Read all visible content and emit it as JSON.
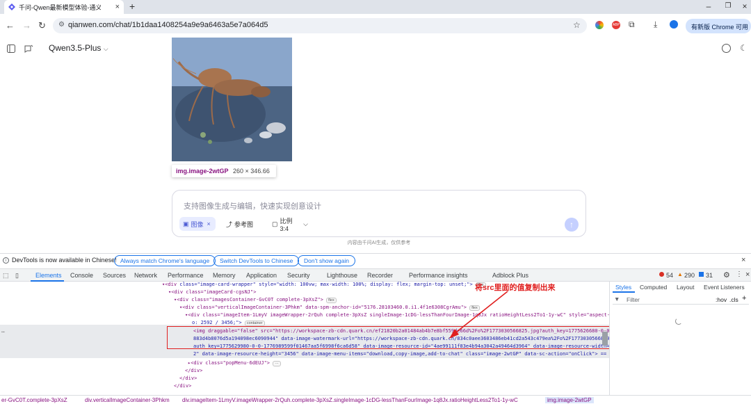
{
  "browser": {
    "tab_title": "千问-Qwen最新模型体验-通义",
    "url": "qianwen.com/chat/1b1daa1408254a9e9a6463a5e7a064d5",
    "new_version_label": "有新版 Chrome 可用"
  },
  "app": {
    "model_name": "Qwen3.5-Plus"
  },
  "image_tooltip": {
    "selector": "img.image-2wtGP",
    "size": "260 × 346.66"
  },
  "chat_input": {
    "placeholder": "支持图像生成与编辑，快速实现创意设计",
    "chip_image": "图像",
    "chip_reference": "参考图",
    "chip_ratio": "比例 3:4",
    "disclaimer": "内容由千问AI生成，仅供参考"
  },
  "devtools_notice": {
    "text": "DevTools is now available in Chinese!",
    "btn_match": "Always match Chrome's language",
    "btn_switch": "Switch DevTools to Chinese",
    "btn_dont_show": "Don't show again"
  },
  "devtools_tabs": [
    "Elements",
    "Console",
    "Sources",
    "Network",
    "Performance",
    "Memory",
    "Application",
    "Security",
    "Lighthouse",
    "Recorder",
    "Performance insights",
    "Adblock Plus"
  ],
  "counters": {
    "errors": "54",
    "warnings": "290",
    "info": "31"
  },
  "styles_tabs": [
    "Styles",
    "Computed",
    "Layout",
    "Event Listeners"
  ],
  "styles_filter": {
    "placeholder": "Filter",
    "hov": ":hov",
    "cls": ".cls"
  },
  "annotation": "将src里面的值复制出来",
  "code": {
    "l1_open": "<div",
    "l1_attrs": " class=\"image-card-wrapper\" style=\"width: 100vw; max-width: 100%; display: flex; margin-top: unset;\">",
    "l2": "<div class=\"imageCard-cgsNJ\">",
    "l3": "<div class=\"imagesContainer-GvC0T complete-3pXsZ\">",
    "l4": "<div class=\"verticalImageContainer-3Phkm\" data-spm-anchor-id=\"5176.28103460.0.i1.4f1e6308CgrAmu\">",
    "l5": "<div class=\"imageItem-1LmyV imageWrapper-2rQuh complete-3pXsZ singleImage-1cDG-lessThanFourImage-1q8Jx ratioHeightLess2To1-1y-wC\" style=\"aspect-rati",
    "l6": "o: 2592 / 3456;\">",
    "l7": "<img draggable=\"false\" src=\"https://workspace-zb-cdn.quark.cn/ef21820b2a01484ab4b7e8bf559de66d%2Fo%2F1773030566825.jpg?auth_key=1775626680-0-0-47a5",
    "l8": "883d4b8076d5a194098ec6090944\" data-image-watermark-url=\"https://workspace-zb-cdn.quark.cn/834c0aee3603486eb41cd2a543c479ea%2Fo%2F1773030566840.png?",
    "l9": "auth_key=1775629980-0-0-1776989599f01467aa5f6998f6ca6d58\" data-image-resource-id=\"4ae99111f83e4b94a3042a49464d3964\" data-image-resource-width=\"259",
    "l10": "2\" data-image-resource-height=\"3456\" data-image-menu-items=\"download,copy-image,add-to-chat\" class=\"image-2wtGP\" data-sc-action=\"onClick\"> == $0",
    "l11": "<div class=\"popMenu-6dEUJ\">",
    "l12": "</div>",
    "l13": "</div>",
    "l14": "</div>",
    "badge_flex": "flex",
    "badge_container": "container"
  },
  "breadcrumbs": [
    "er-GvC0T.complete-3pXsZ",
    "div.verticalImageContainer-3Phkm",
    "div.imageItem-1LmyV.imageWrapper-2rQuh.complete-3pXsZ.singleImage-1cDG-lessThanFourImage-1q8Jx.ratioHeightLess2To1-1y-wC",
    "img.image-2wtGP"
  ],
  "colors": {
    "accent": "#1a73e8",
    "annotation_red": "#e01e1e",
    "tag_purple": "#881280"
  }
}
